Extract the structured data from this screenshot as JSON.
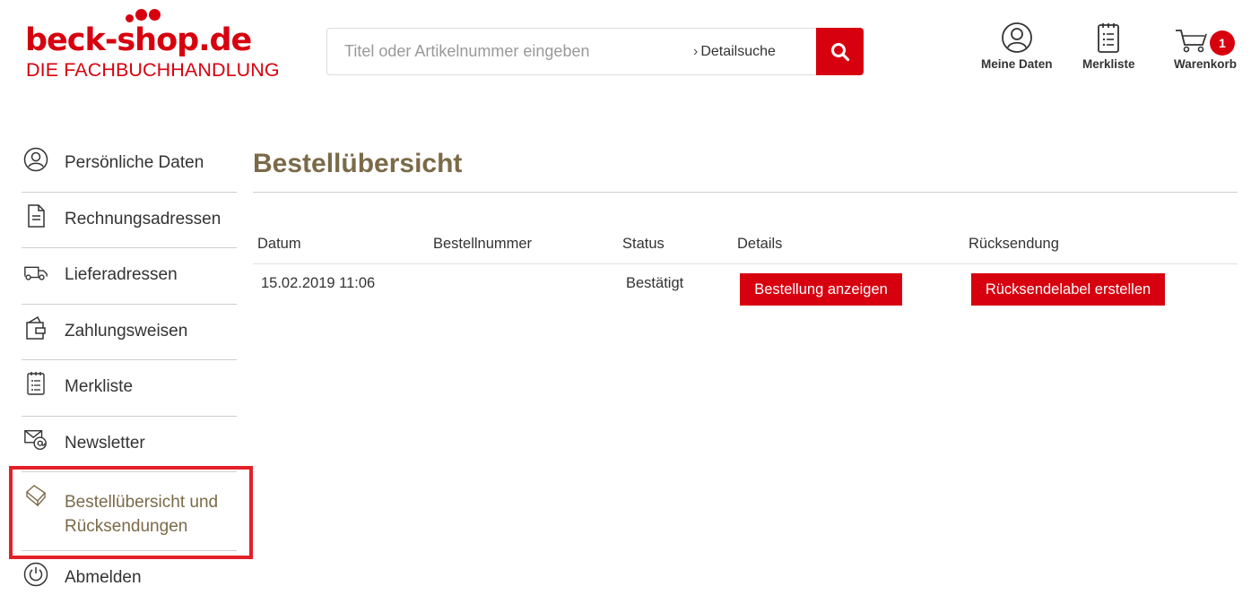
{
  "logo": {
    "title": "beck-shop.de",
    "subtitle": "DIE FACHBUCHHANDLUNG"
  },
  "search": {
    "placeholder": "Titel oder Artikelnummer eingeben",
    "value": "",
    "detail_chevron": "›",
    "detail_link": "Detailsuche"
  },
  "header": {
    "my_data": "Meine Daten",
    "watchlist": "Merkliste",
    "cart": "Warenkorb",
    "cart_count": "1"
  },
  "sidebar": {
    "items": [
      {
        "label": "Persönliche Daten",
        "icon": "user-icon"
      },
      {
        "label": "Rechnungsadressen",
        "icon": "document-icon"
      },
      {
        "label": "Lieferadressen",
        "icon": "truck-icon"
      },
      {
        "label": "Zahlungsweisen",
        "icon": "wallet-icon"
      },
      {
        "label": "Merkliste",
        "icon": "checklist-icon"
      },
      {
        "label": "Newsletter",
        "icon": "mail-at-icon"
      },
      {
        "label": "Bestellübersicht und Rücksendungen",
        "icon": "package-icon",
        "active": true
      },
      {
        "label": "Abmelden",
        "icon": "power-icon"
      }
    ]
  },
  "main": {
    "title": "Bestellübersicht",
    "columns": {
      "date": "Datum",
      "order_number": "Bestellnummer",
      "status": "Status",
      "details": "Details",
      "return": "Rücksendung"
    },
    "rows": [
      {
        "date": "15.02.2019 11:06",
        "order_number": "",
        "status": "Bestätigt",
        "details_button": "Bestellung anzeigen",
        "return_button": "Rücksendelabel erstellen"
      }
    ]
  },
  "colors": {
    "brand_red": "#d7000f",
    "title_brown": "#7b6a48",
    "highlight_frame": "#e2202a"
  }
}
